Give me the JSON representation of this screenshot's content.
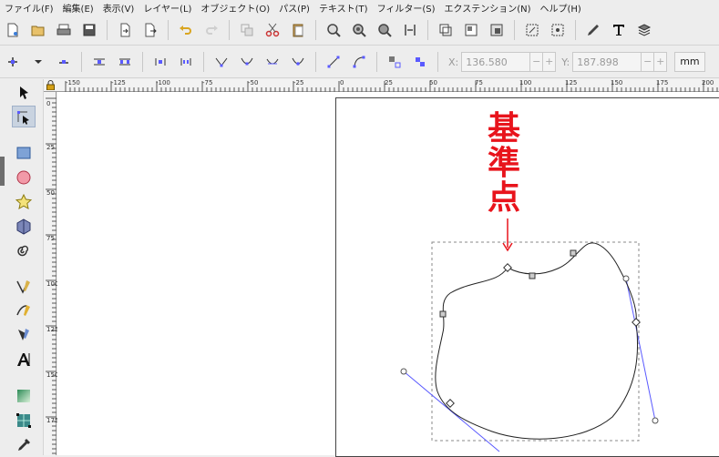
{
  "menu": [
    "ファイル(F)",
    "編集(E)",
    "表示(V)",
    "レイヤー(L)",
    "オブジェクト(O)",
    "パス(P)",
    "テキスト(T)",
    "フィルター(S)",
    "エクステンション(N)",
    "ヘルプ(H)"
  ],
  "commands_bar": {
    "icons": [
      "new-document-icon",
      "open-file-icon",
      "print-icon",
      "save-icon",
      "import-icon",
      "export-icon",
      "undo-icon",
      "redo-icon",
      "duplicate-icon",
      "cut-icon",
      "paste-icon",
      "zoom-selection-icon",
      "zoom-drawing-icon",
      "zoom-page-icon",
      "zoom-page-width-icon",
      "clone-icon",
      "group-icon",
      "ungroup-icon",
      "fill-stroke-icon",
      "xml-editor-icon",
      "edit-path-icon",
      "text-tool-icon",
      "layers-icon"
    ]
  },
  "node_toolbar": {
    "x_label": "X:",
    "x_value": "136.580",
    "y_label": "Y:",
    "y_value": "187.898",
    "spin_minus": "−",
    "spin_plus": "+",
    "unit": "mm"
  },
  "rulers": {
    "top_labels": [
      "-150",
      "-125",
      "-100",
      "-75",
      "-50",
      "-25",
      "0",
      "25",
      "50",
      "75",
      "100",
      "125",
      "150",
      "175",
      "200"
    ],
    "left_labels": [
      "0",
      "25",
      "50",
      "75",
      "100",
      "125",
      "150",
      "175"
    ]
  },
  "tools": [
    "selector-tool-icon",
    "node-tool-icon",
    "rectangle-tool-icon",
    "ellipse-tool-icon",
    "star-tool-icon",
    "3d-box-tool-icon",
    "spiral-tool-icon",
    "pencil-tool-icon",
    "pen-tool-icon",
    "calligraphy-tool-icon",
    "text-tool-icon",
    "gradient-tool-icon",
    "mesh-tool-icon",
    "dropper-tool-icon"
  ],
  "canvas": {
    "annotation": "基準点",
    "annotation_color": "#e8141c",
    "handle_color": "#5a5aff"
  }
}
